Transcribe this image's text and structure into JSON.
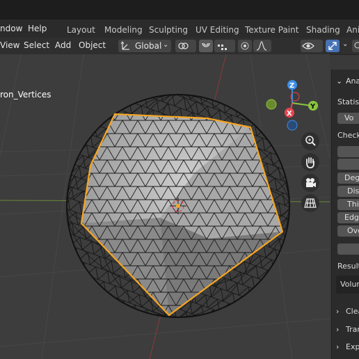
{
  "topbar": {
    "menu": [
      "ndow",
      "Help"
    ],
    "workspace_tabs": [
      "Layout",
      "Modeling",
      "Sculpting",
      "UV Editing",
      "Texture Paint",
      "Shading",
      "Ani"
    ]
  },
  "header": {
    "menu": [
      "View",
      "Select",
      "Add",
      "Object"
    ],
    "transform_orientation": "Global"
  },
  "viewport": {
    "object_name": "ron_Vertices",
    "gizmo": {
      "z": "Z",
      "x": "X",
      "y": "Y"
    }
  },
  "npanel": {
    "section_title": "Ana",
    "statistics_label": "Statisti",
    "volume_button": "Vo",
    "checks_label": "Check",
    "checks": [
      "Deg",
      "Dis",
      "Thi",
      "Edge",
      "Ove"
    ],
    "result_label": "Result",
    "result_value": "Volum",
    "sections": [
      "Clea",
      "Tran",
      "Exp"
    ]
  },
  "colors": {
    "accent": "#4772b3",
    "selection_outline": "#f5a623",
    "axis_x": "#e64550",
    "axis_y": "#8bc53f",
    "axis_z": "#3e8ee5"
  }
}
